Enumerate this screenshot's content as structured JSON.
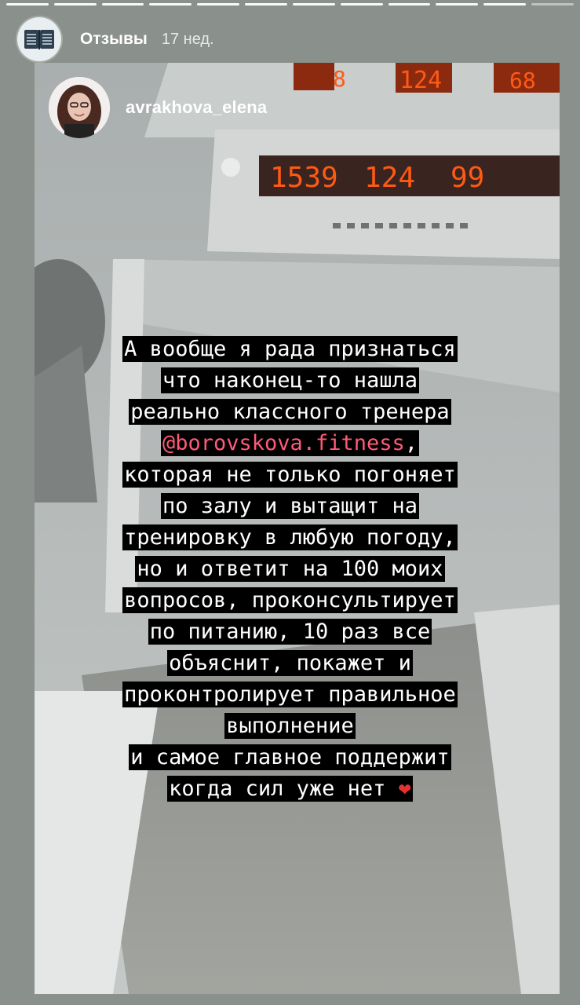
{
  "story": {
    "title": "Отзывы",
    "time_ago": "17 нед.",
    "progress_count": 12
  },
  "repost": {
    "username": "avrakhova_elena",
    "display_digits": [
      "8",
      "124",
      "68",
      "1539",
      "124",
      "99"
    ]
  },
  "caption": {
    "lines": [
      "А вообще я рада признаться",
      "что наконец-то нашла",
      "реально классного тренера",
      "которая не только погоняет",
      "по залу и вытащит на",
      "тренировку в любую погоду,",
      "но и ответит на 100 моих",
      "вопросов, проконсультирует",
      "по питанию, 10 раз все",
      "объяснит, покажет и",
      "проконтролирует правильное",
      "выполнение",
      "и самое главное поддержит",
      "когда сил уже нет"
    ],
    "mention": "@borovskova.fitness",
    "mention_suffix": ",",
    "heart": "❤"
  },
  "colors": {
    "mention": "#ff5a78",
    "heart": "#e8312f",
    "digits": "#ff5a14"
  }
}
